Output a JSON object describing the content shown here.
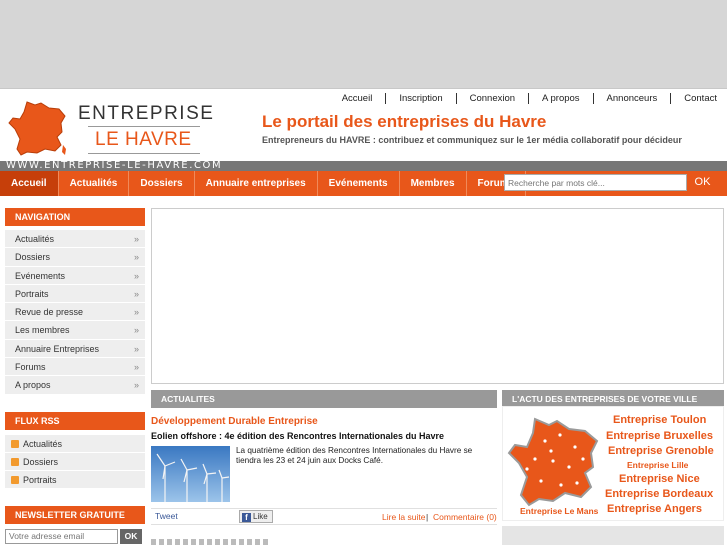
{
  "header": {
    "logo_line1": "ENTREPRISE",
    "logo_line2": "LE HAVRE",
    "url": "WWW.ENTREPRISE-LE-HAVRE.COM",
    "top_links": [
      "Accueil",
      "Inscription",
      "Connexion",
      "A propos",
      "Annonceurs",
      "Contact"
    ],
    "tagline": "Le portail des entreprises du Havre",
    "subtagline": "Entrepreneurs du HAVRE : contribuez et communiquez sur le 1er média collaboratif pour décideur"
  },
  "nav": {
    "tabs": [
      "Accueil",
      "Actualités",
      "Dossiers",
      "Annuaire entreprises",
      "Evénements",
      "Membres",
      "Forums"
    ],
    "active_tab": "Accueil",
    "search_placeholder": "Recherche par mots clé...",
    "search_button": "OK"
  },
  "sidebar": {
    "navigation_title": "NAVIGATION",
    "items": [
      "Actualités",
      "Dossiers",
      "Evénements",
      "Portraits",
      "Revue de presse",
      "Les membres",
      "Annuaire Entreprises",
      "Forums",
      "A propos"
    ],
    "chevron": "»",
    "rss_title": "FLUX RSS",
    "rss_items": [
      "Actualités",
      "Dossiers",
      "Portraits"
    ],
    "newsletter_title": "NEWSLETTER GRATUITE",
    "newsletter_placeholder": "Votre adresse email",
    "newsletter_button": "OK"
  },
  "news": {
    "section_title": "ACTUALITES",
    "category": "Développement Durable Entreprise",
    "headline": "Eolien offshore : 4e édition des Rencontres Internationales du Havre",
    "excerpt": "La quatrième édition des Rencontres Internationales du Havre se tiendra les 23 et 24 juin aux Docks Café.",
    "tweet": "Tweet",
    "like": "Like",
    "read_more": "Lire la suite",
    "separator": "|",
    "comments": "Commentaire (0)"
  },
  "cities": {
    "section_title": "L'ACTU DES ENTREPRISES DE VOTRE VILLE",
    "list": [
      "Entreprise Toulon",
      "Entreprise Bruxelles",
      "Entreprise Grenoble",
      "Entreprise Lille",
      "Entreprise Nice",
      "Entreprise Bordeaux",
      "Entreprise Le Mans",
      "Entreprise Angers"
    ]
  },
  "colors": {
    "brand": "#e8571a",
    "brand_dark": "#c63f0a",
    "grey_head": "#999999"
  },
  "icons": {
    "rss": "rss-icon",
    "facebook": "facebook-icon",
    "france_map": "france-map-icon"
  }
}
